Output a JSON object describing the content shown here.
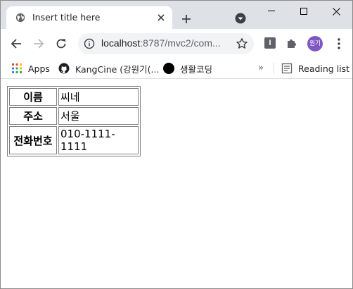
{
  "browser": {
    "tab": {
      "title": "Insert title here"
    },
    "url": {
      "host": "localhost",
      "rest": ":8787/mvc2/com..."
    },
    "profile_initials": "원기"
  },
  "bookmarks": [
    {
      "label": "Apps",
      "icon": "apps-grid-icon"
    },
    {
      "label": "KangCine (강원기(...",
      "icon": "github-icon"
    },
    {
      "label": "생활코딩",
      "icon": "black-circle-icon"
    }
  ],
  "reading_list": {
    "label": "Reading list"
  },
  "table": {
    "rows": [
      {
        "header": "이름",
        "value": "씨네"
      },
      {
        "header": "주소",
        "value": "서울"
      },
      {
        "header": "전화번호",
        "value": "010-1111-1111"
      }
    ]
  }
}
